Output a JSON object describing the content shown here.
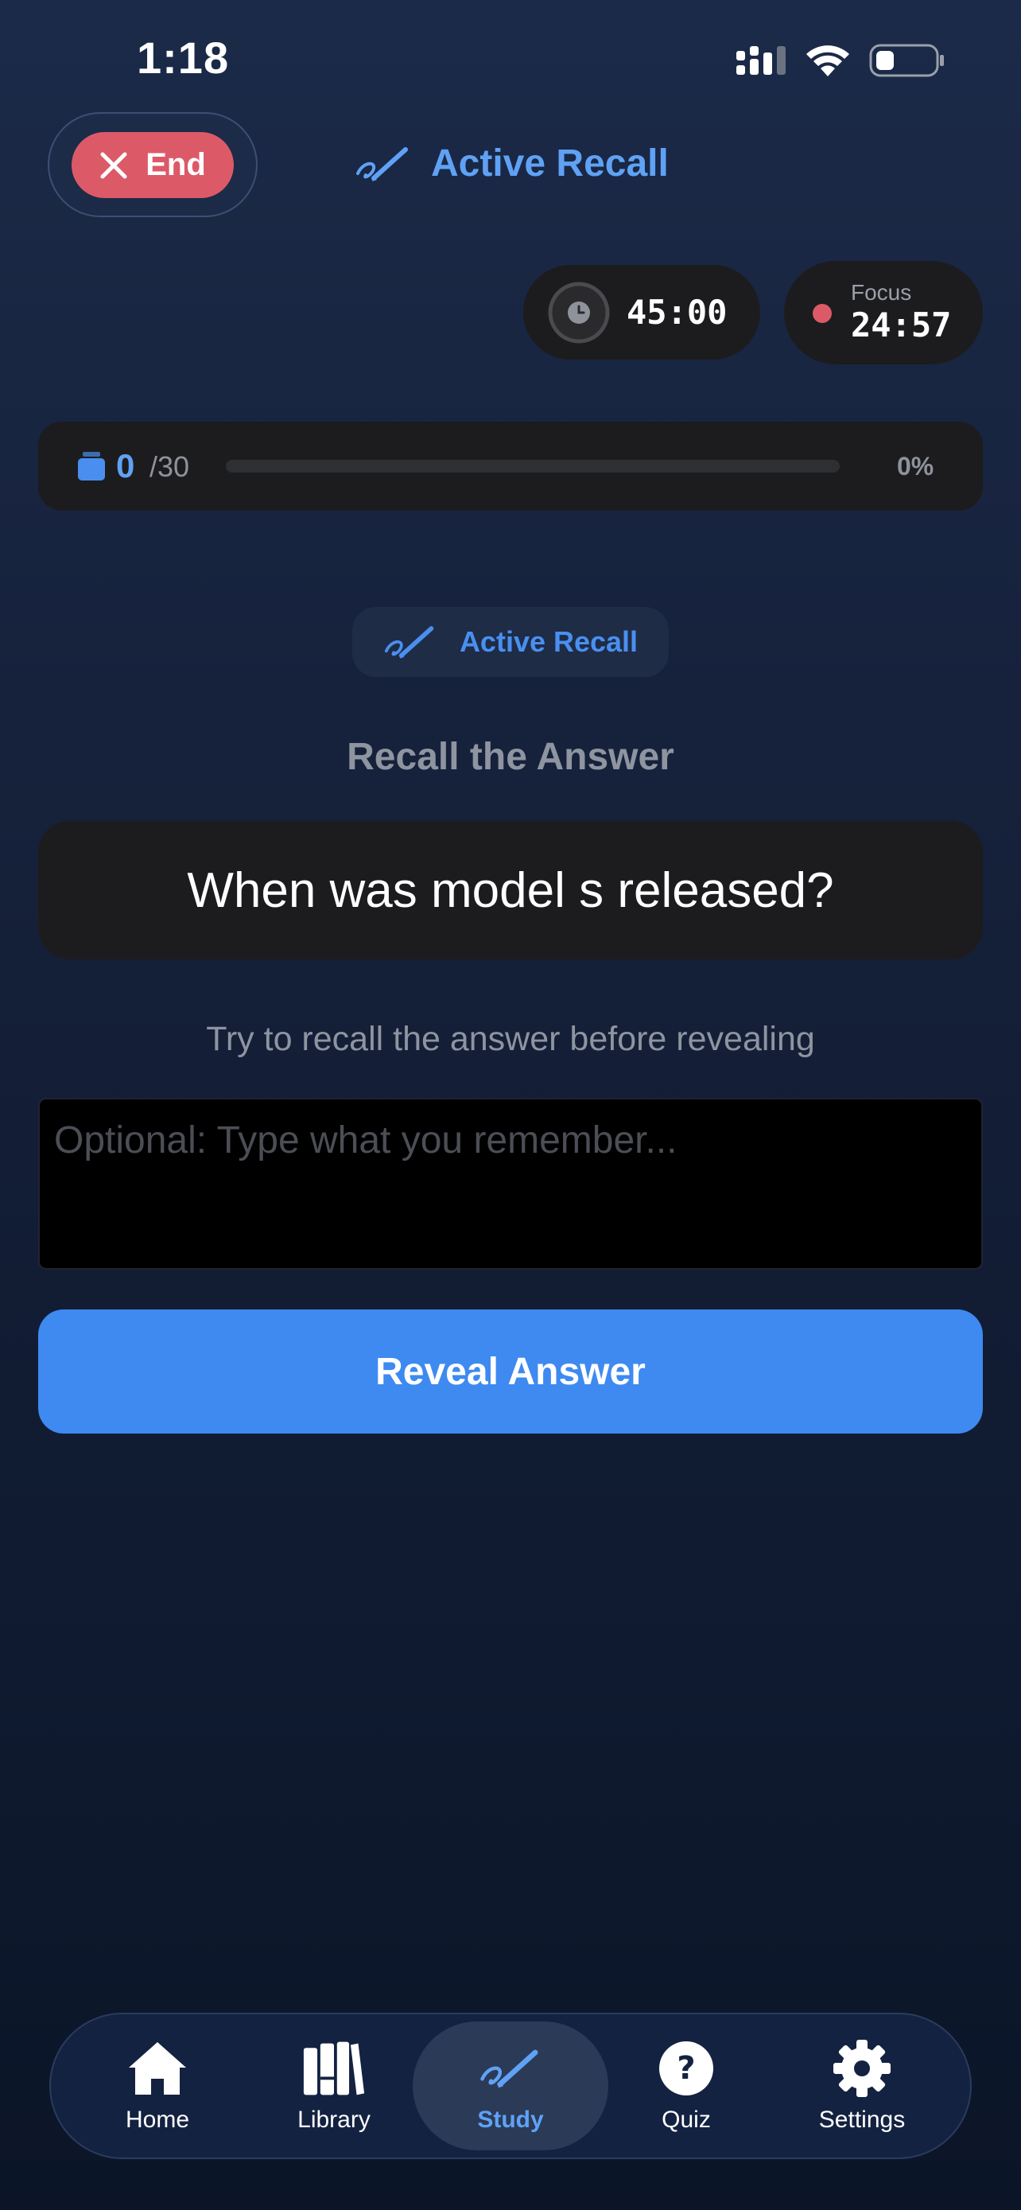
{
  "status_bar": {
    "time": "1:18"
  },
  "header": {
    "end_label": "End",
    "title": "Active Recall"
  },
  "timers": {
    "session": "45:00",
    "focus_label": "Focus",
    "focus_time": "24:57"
  },
  "progress": {
    "current": "0",
    "total": "/30",
    "percent_label": "0%",
    "fraction": 0
  },
  "mode_chip": {
    "label": "Active Recall"
  },
  "card": {
    "prompt_title": "Recall the Answer",
    "question": "When was model s released?",
    "hint": "Try to recall the answer before revealing"
  },
  "input": {
    "placeholder": "Optional: Type what you remember...",
    "value": ""
  },
  "reveal_button": {
    "label": "Reveal Answer"
  },
  "tabs": [
    {
      "label": "Home",
      "icon": "home-icon"
    },
    {
      "label": "Library",
      "icon": "library-icon"
    },
    {
      "label": "Study",
      "icon": "pencil-scribble-icon",
      "active": true
    },
    {
      "label": "Quiz",
      "icon": "question-circle-icon"
    },
    {
      "label": "Settings",
      "icon": "gear-icon"
    }
  ],
  "colors": {
    "accent": "#4a8ff0",
    "danger": "#dc5a68",
    "card": "#1c1c1e"
  }
}
